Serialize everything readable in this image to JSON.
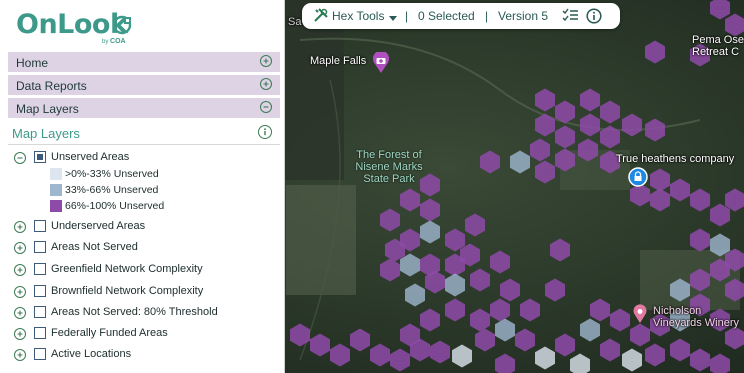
{
  "brand": {
    "name": "OnLook",
    "by": "by",
    "company": "COA"
  },
  "sidebar": {
    "accordions": [
      {
        "label": "Home",
        "state": "plus"
      },
      {
        "label": "Data Reports",
        "state": "plus"
      },
      {
        "label": "Map Layers",
        "state": "minus"
      }
    ],
    "section_title": "Map Layers",
    "layers": [
      {
        "label": "Unserved Areas",
        "toggle": "minus",
        "checked": "partial"
      },
      {
        "label": "Underserved Areas",
        "toggle": "plus",
        "checked": "none"
      },
      {
        "label": "Areas Not Served",
        "toggle": "plus",
        "checked": "none"
      },
      {
        "label": "Greenfield Network Complexity",
        "toggle": "plus",
        "checked": "none"
      },
      {
        "label": "Brownfield Network Complexity",
        "toggle": "plus",
        "checked": "none"
      },
      {
        "label": "Areas Not Served: 80% Threshold",
        "toggle": "plus",
        "checked": "none"
      },
      {
        "label": "Federally Funded Areas",
        "toggle": "plus",
        "checked": "none"
      },
      {
        "label": "Active Locations",
        "toggle": "plus",
        "checked": "none"
      }
    ],
    "legend": [
      {
        "label": ">0%-33% Unserved",
        "color": "#dde6ef"
      },
      {
        "label": "33%-66% Unserved",
        "color": "#9fb6cf"
      },
      {
        "label": "66%-100% Unserved",
        "color": "#8e4aa8"
      }
    ]
  },
  "toolbar": {
    "hex_tools": "Hex Tools",
    "separator": "|",
    "selected": "0 Selected",
    "version": "Version 5"
  },
  "map": {
    "labels": {
      "maple_falls": "Maple Falls",
      "forest_line1": "The Forest of",
      "forest_line2": "Nisene Marks",
      "forest_line3": "State Park",
      "true_heathens": "True heathens company",
      "pema_line1": "Pema Ose",
      "pema_line2": "Retreat C",
      "nicholson_line1": "Nicholson",
      "nicholson_line2": "Vineyards Winery",
      "edge_sa": "Sa"
    },
    "colors": {
      "purple": "#8e4aa8",
      "light_blue": "#9fb6cf",
      "pale": "#dde6ef",
      "accent": "#3d9a8a"
    }
  }
}
